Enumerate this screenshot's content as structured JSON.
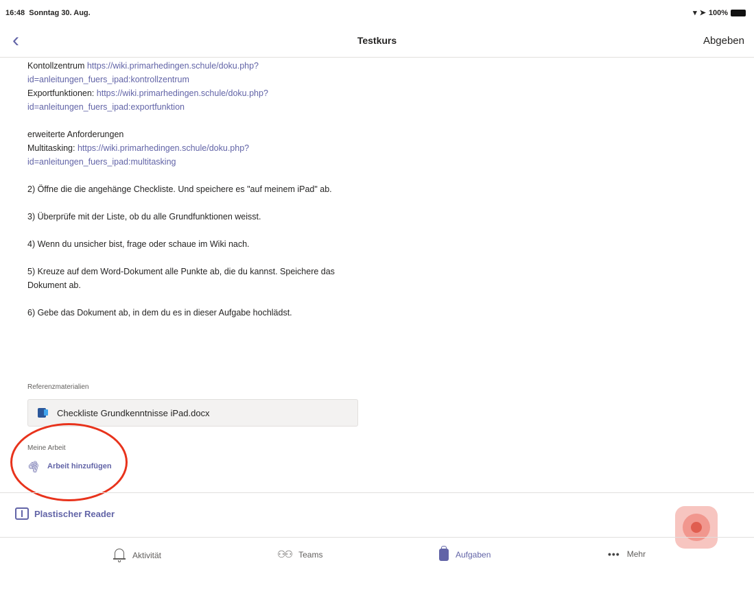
{
  "status_bar": {
    "time": "16:48",
    "date": "Sonntag 30. Aug.",
    "battery": "100%"
  },
  "nav": {
    "back_icon": "chevron-left-icon",
    "title": "Testkurs",
    "submit_label": "Abgeben"
  },
  "instructions": {
    "block1": [
      {
        "label": "Kontollzentrum ",
        "link1": "https://wiki.primarhedingen.schule/doku.php?",
        "link2": "id=anleitungen_fuers_ipad:kontrollzentrum"
      },
      {
        "label": "Exportfunktionen: ",
        "link1": "https://wiki.primarhedingen.schule/doku.php?",
        "link2": "id=anleitungen_fuers_ipad:exportfunktion"
      }
    ],
    "extended_heading": "erweiterte Anforderungen",
    "multitasking": {
      "label": "Multitasking: ",
      "link1": "https://wiki.primarhedingen.schule/doku.php?",
      "link2": "id=anleitungen_fuers_ipad:multitasking"
    },
    "steps": [
      "2) Öffne die die angehänge Checkliste. Und speichere es \"auf meinem iPad\" ab.",
      "3) Überprüfe mit der Liste, ob du alle Grundfunktionen weisst.",
      "4) Wenn du unsicher bist, frage oder schaue im Wiki nach.",
      "5) Kreuze auf dem Word-Dokument alle Punkte ab, die du kannst. Speichere das Dokument ab.",
      "6) Gebe das Dokument ab, in dem du es in dieser Aufgabe hochlädst."
    ]
  },
  "reference": {
    "label": "Referenzmaterialien",
    "file_name": "Checkliste Grundkenntnisse iPad.docx",
    "file_icon": "word-document-icon"
  },
  "my_work": {
    "label": "Meine Arbeit",
    "add_label": "Arbeit hinzufügen",
    "add_icon": "paperclip-icon"
  },
  "reader": {
    "label": "Plastischer Reader",
    "icon": "immersive-reader-icon"
  },
  "tabs": [
    {
      "label": "Aktivität",
      "icon": "bell-icon",
      "active": false
    },
    {
      "label": "Teams",
      "icon": "teams-icon",
      "active": false
    },
    {
      "label": "Aufgaben",
      "icon": "assignments-icon",
      "active": true
    },
    {
      "label": "Mehr",
      "icon": "more-dots-icon",
      "active": false
    }
  ],
  "colors": {
    "accent": "#6264a7",
    "highlight": "#e8331c",
    "text": "#252423"
  }
}
